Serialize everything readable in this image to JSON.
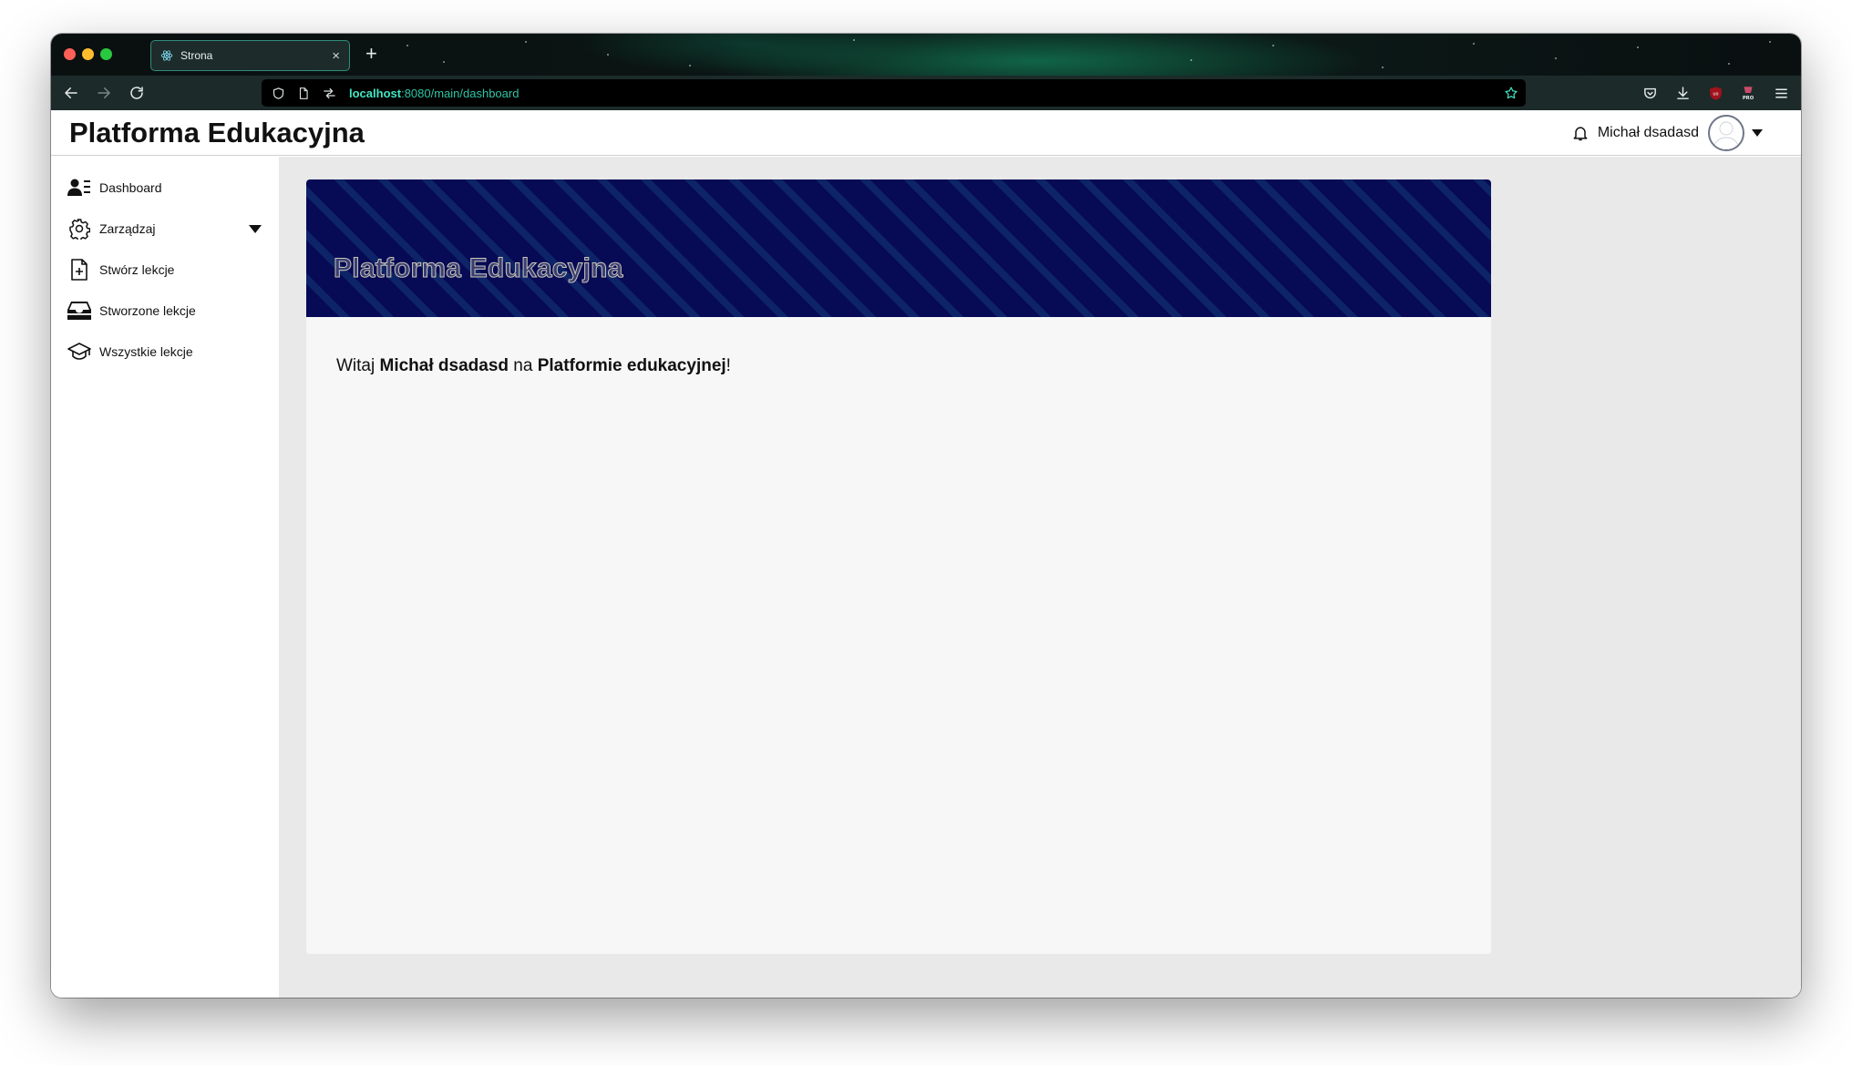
{
  "browser": {
    "tab_title": "Strona",
    "url_host": "localhost",
    "url_path": ":8080/main/dashboard"
  },
  "app": {
    "brand": "Platforma Edukacyjna",
    "user_name": "Michał dsadasd"
  },
  "sidebar": {
    "items": [
      {
        "label": "Dashboard",
        "icon": "user-list-icon"
      },
      {
        "label": "Zarządzaj",
        "icon": "gear-icon",
        "expandable": true
      },
      {
        "label": "Stwórz lekcje",
        "icon": "file-plus-icon"
      },
      {
        "label": "Stworzone lekcje",
        "icon": "inbox-tray-icon"
      },
      {
        "label": "Wszystkie lekcje",
        "icon": "graduation-cap-icon"
      }
    ]
  },
  "main": {
    "banner_title": "Platforma Edukacyjna",
    "welcome_prefix": "Witaj ",
    "welcome_user": "Michał dsadasd",
    "welcome_middle": " na ",
    "welcome_platform": "Platformie edukacyjnej",
    "welcome_suffix": "!"
  },
  "colors": {
    "banner_dark": "#070a55",
    "banner_stripe": "#0e2468",
    "url_accent": "#41e6c3",
    "tab_border": "#2f8d7c"
  }
}
